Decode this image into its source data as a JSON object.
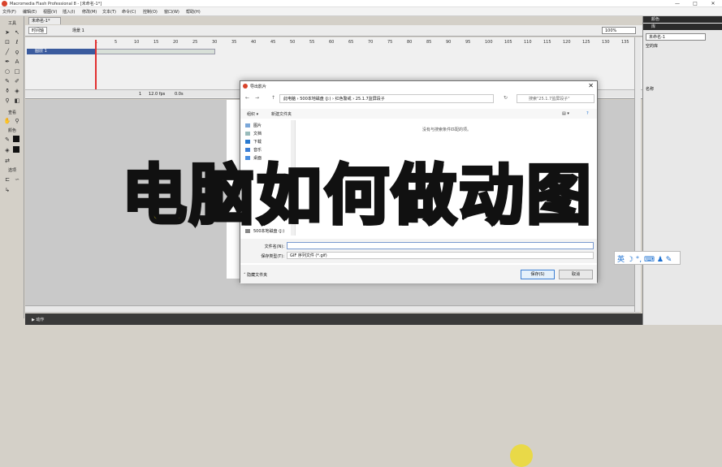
{
  "window": {
    "title": "Macromedia Flash Professional 8 - [未命名-1*]",
    "controls": [
      "—",
      "□",
      "✕"
    ]
  },
  "menu": [
    "文件(F)",
    "编辑(E)",
    "视图(V)",
    "插入(I)",
    "修改(M)",
    "文本(T)",
    "命令(C)",
    "控制(O)",
    "窗口(W)",
    "帮助(H)"
  ],
  "tools": {
    "header": "工具",
    "view_label": "查看",
    "colors_label": "颜色",
    "options_label": "选项"
  },
  "document": {
    "tab": "未命名-1*",
    "timeline_btn": "时间轴",
    "scene": "场景 1",
    "zoom": "100%"
  },
  "timeline": {
    "ruler": [
      "1",
      "5",
      "10",
      "15",
      "20",
      "25",
      "30",
      "35",
      "40",
      "45",
      "50",
      "55",
      "60",
      "65",
      "70",
      "75",
      "80",
      "85",
      "90",
      "95",
      "100",
      "105",
      "110",
      "115",
      "120",
      "125",
      "130",
      "135"
    ],
    "layer_name": "图层 1",
    "current_frame": "1",
    "fps": "12.0 fps",
    "time": "0.0s"
  },
  "right_panel": {
    "library_header": "颜色",
    "library_header2": "库",
    "doc_select": "未命名-1",
    "empty_lib": "空的库",
    "name_col": "名称"
  },
  "dialog": {
    "title": "导出影片",
    "path": [
      "此电脑",
      "500本地磁盘 (J:)",
      "红色警戒",
      "25.1.7监屏段子"
    ],
    "search_placeholder": "搜索\"25.1.7监屏段子\"",
    "organize": "组织 ▾",
    "new_folder": "新建文件夹",
    "nav_items": [
      "图片",
      "文档",
      "下载",
      "音乐",
      "桌面",
      "500本地磁盘 (J:)"
    ],
    "empty_message": "没有与搜索条件匹配的项。",
    "filename_label": "文件名(N):",
    "filename_value": "",
    "type_label": "保存类型(T):",
    "type_value": "GIF 序列文件 (*.gif)",
    "hide_folders": "隐藏文件夹",
    "save_btn": "保存(S)",
    "cancel_btn": "取消"
  },
  "ime": "英 ☽ °, ⌨ ♟ ✎",
  "actions_bar": "▶ 动作",
  "overlay_text": "电脑如何做动图",
  "colors": {
    "overlay_fill": "#f6e51a",
    "overlay_stroke": "#111111",
    "layer_sel": "#3b5b9e",
    "playhead": "#e23030"
  }
}
